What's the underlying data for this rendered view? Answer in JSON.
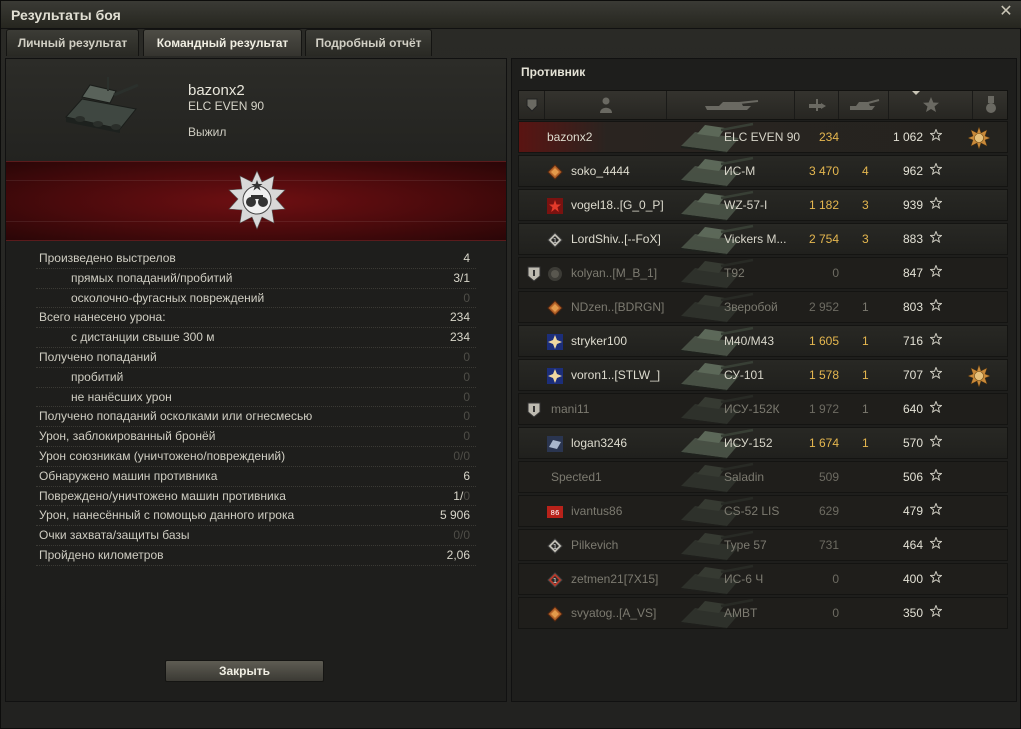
{
  "window": {
    "title": "Результаты боя",
    "close_glyph": "✕"
  },
  "tabs": [
    {
      "label": "Личный результат"
    },
    {
      "label": "Командный результат"
    },
    {
      "label": "Подробный отчёт"
    }
  ],
  "player": {
    "name": "bazonx2",
    "vehicle": "ELC EVEN 90",
    "status": "Выжил"
  },
  "stats": [
    {
      "label": "Произведено выстрелов",
      "value": "4",
      "indent": false,
      "dim": false
    },
    {
      "label": "прямых попаданий/пробитий",
      "value": "3/1",
      "indent": true,
      "dim": false
    },
    {
      "label": "осколочно-фугасных повреждений",
      "value": "0",
      "indent": true,
      "dim": true
    },
    {
      "label": "Всего нанесено урона:",
      "value": "234",
      "indent": false,
      "dim": false
    },
    {
      "label": "с дистанции свыше 300 м",
      "value": "234",
      "indent": true,
      "dim": false
    },
    {
      "label": "Получено попаданий",
      "value": "0",
      "indent": false,
      "dim": true
    },
    {
      "label": "пробитий",
      "value": "0",
      "indent": true,
      "dim": true
    },
    {
      "label": "не нанёсших урон",
      "value": "0",
      "indent": true,
      "dim": true
    },
    {
      "label": "Получено попаданий осколками или огнесмесью",
      "value": "0",
      "indent": false,
      "dim": true
    },
    {
      "label": "Урон, заблокированный бронёй",
      "value": "0",
      "indent": false,
      "dim": true
    },
    {
      "label": "Урон союзникам (уничтожено/повреждений)",
      "value": "0/0",
      "indent": false,
      "dim": true
    },
    {
      "label": "Обнаружено машин противника",
      "value": "6",
      "indent": false,
      "dim": false
    },
    {
      "label": "Повреждено/уничтожено машин противника",
      "value_a": "1/",
      "value_b": "0",
      "indent": false,
      "split": true
    },
    {
      "label": "Урон, нанесённый с помощью данного игрока",
      "value": "5 906",
      "indent": false,
      "dim": false
    },
    {
      "label": "Очки захвата/защиты базы",
      "value": "0/0",
      "indent": false,
      "dim": true
    },
    {
      "label": "Пройдено километров",
      "value": "2,06",
      "indent": false,
      "dim": false
    }
  ],
  "close_button": "Закрыть",
  "enemy_header": "Противник",
  "rows": [
    {
      "name": "bazonx2",
      "vehicle": "ELC EVEN 90",
      "damage": "234",
      "frags": "",
      "xp": "1 062",
      "self": true,
      "dead": false,
      "rank": false,
      "icon": "none",
      "medal": true
    },
    {
      "name": "soko_4444",
      "vehicle": "ИС-М",
      "damage": "3 470",
      "frags": "4",
      "xp": "962",
      "dead": false,
      "rank": false,
      "icon": "emblem-orange",
      "medal": false
    },
    {
      "name": "vogel18..[G_0_P]",
      "vehicle": "WZ-57-I",
      "damage": "1 182",
      "frags": "3",
      "xp": "939",
      "dead": false,
      "rank": false,
      "icon": "emblem-red-star",
      "medal": false
    },
    {
      "name": "LordShiv..[--FoX]",
      "vehicle": "Vickers M...",
      "damage": "2 754",
      "frags": "3",
      "xp": "883",
      "dead": false,
      "rank": false,
      "icon": "emblem-diamond",
      "medal": false
    },
    {
      "name": "kolyan..[M_B_1]",
      "vehicle": "T92",
      "damage": "0",
      "frags": "",
      "xp": "847",
      "dead": true,
      "rank": true,
      "icon": "emblem-grey",
      "medal": false
    },
    {
      "name": "NDzen..[BDRGN]",
      "vehicle": "Зверобой",
      "damage": "2 952",
      "frags": "1",
      "xp": "803",
      "dead": true,
      "rank": false,
      "icon": "emblem-orange",
      "medal": false
    },
    {
      "name": "stryker100",
      "vehicle": "M40/M43",
      "damage": "1 605",
      "frags": "1",
      "xp": "716",
      "dead": false,
      "rank": false,
      "icon": "emblem-blue",
      "medal": false
    },
    {
      "name": "voron1..[STLW_]",
      "vehicle": "СУ-101",
      "damage": "1 578",
      "frags": "1",
      "xp": "707",
      "dead": false,
      "rank": false,
      "icon": "emblem-blue",
      "medal": true
    },
    {
      "name": "mani11",
      "vehicle": "ИСУ-152К",
      "damage": "1 972",
      "frags": "1",
      "xp": "640",
      "dead": true,
      "rank": true,
      "icon": "none",
      "medal": false
    },
    {
      "name": "logan3246",
      "vehicle": "ИСУ-152",
      "damage": "1 674",
      "frags": "1",
      "xp": "570",
      "dead": false,
      "rank": false,
      "icon": "emblem-steel",
      "medal": false
    },
    {
      "name": "Spected1",
      "vehicle": "Saladin",
      "damage": "509",
      "frags": "",
      "xp": "506",
      "dead": true,
      "rank": false,
      "icon": "none",
      "medal": false
    },
    {
      "name": "ivantus86",
      "vehicle": "CS-52 LIS",
      "damage": "629",
      "frags": "",
      "xp": "479",
      "dead": true,
      "rank": false,
      "icon": "emblem-red",
      "medal": false
    },
    {
      "name": "Pilkevich",
      "vehicle": "Type 57",
      "damage": "731",
      "frags": "",
      "xp": "464",
      "dead": true,
      "rank": false,
      "icon": "emblem-diamond",
      "medal": false
    },
    {
      "name": "zetmen21[7X15]",
      "vehicle": "ИС-6 Ч",
      "damage": "0",
      "frags": "",
      "xp": "400",
      "dead": true,
      "rank": false,
      "icon": "emblem-diamond-red",
      "medal": false
    },
    {
      "name": "svyatog..[A_VS]",
      "vehicle": "AMBT",
      "damage": "0",
      "frags": "",
      "xp": "350",
      "dead": true,
      "rank": false,
      "icon": "emblem-orange",
      "medal": false
    }
  ],
  "colors": {
    "accent_damage": "#e5b74f",
    "banner_red": "#6e0f12",
    "self_row": "#5a1412"
  }
}
